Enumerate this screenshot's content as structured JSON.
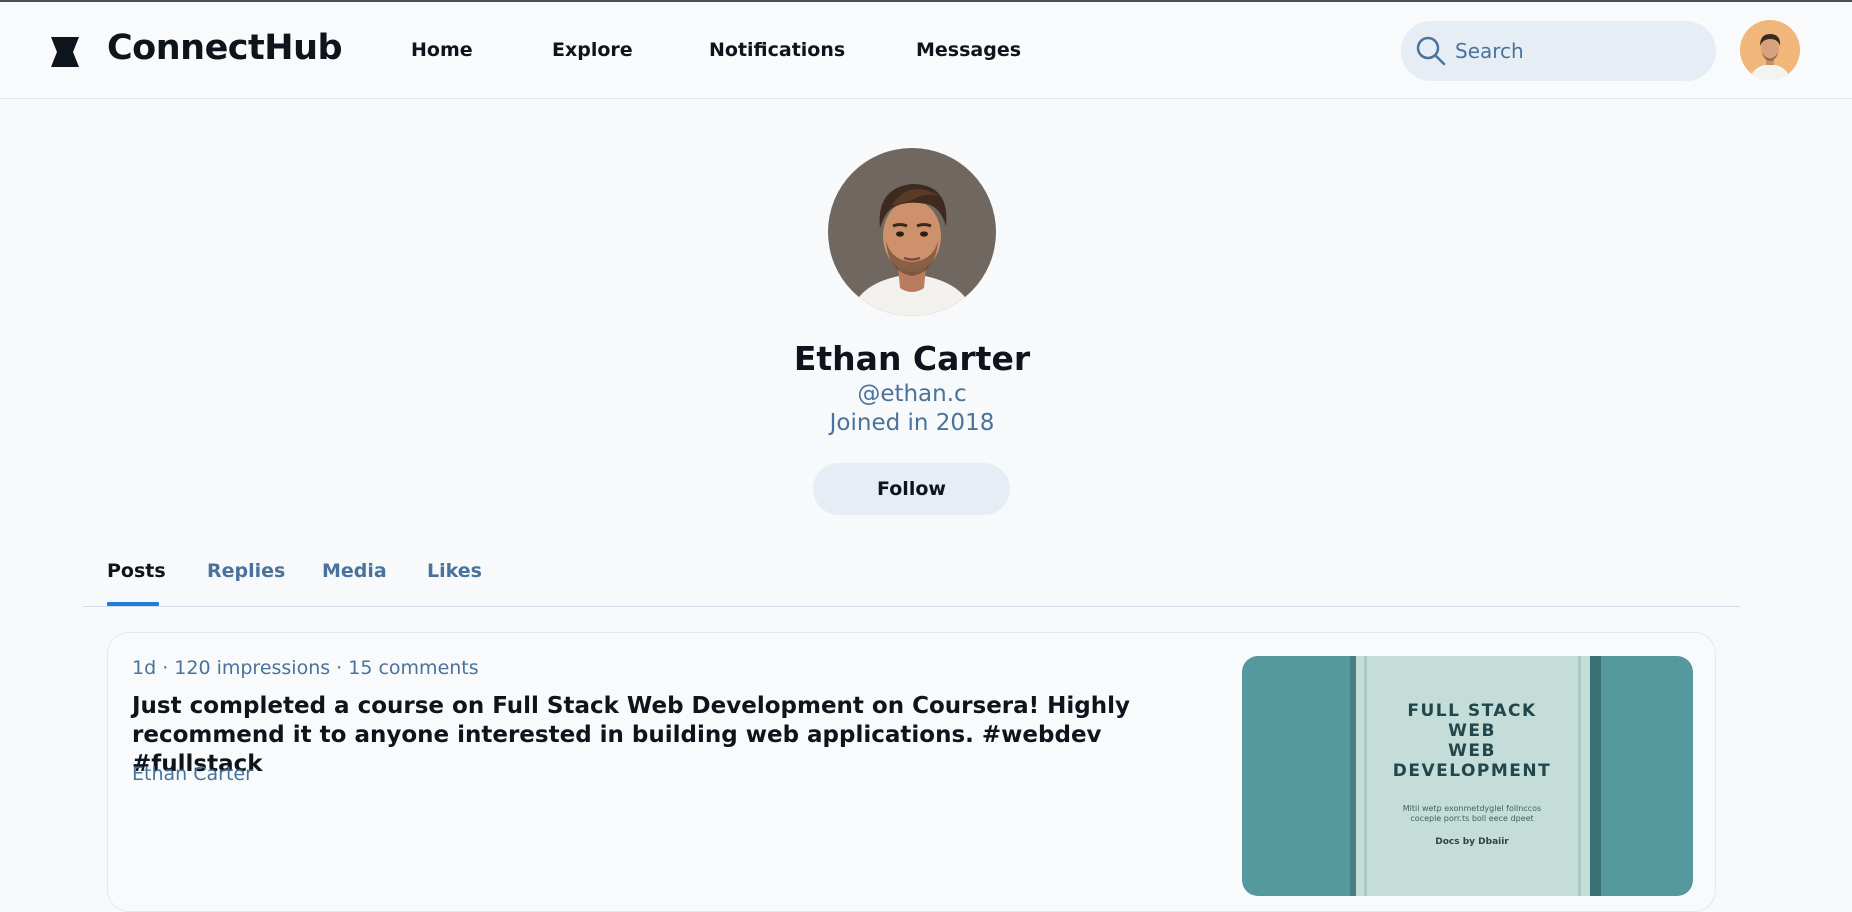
{
  "app": {
    "brand": "ConnectHub"
  },
  "nav": {
    "items": [
      "Home",
      "Explore",
      "Notifications",
      "Messages"
    ]
  },
  "search": {
    "placeholder": "Search"
  },
  "profile": {
    "name": "Ethan Carter",
    "handle": "@ethan.c",
    "joined": "Joined in 2018",
    "follow_label": "Follow"
  },
  "tabs": [
    {
      "label": "Posts",
      "active": true
    },
    {
      "label": "Replies",
      "active": false
    },
    {
      "label": "Media",
      "active": false
    },
    {
      "label": "Likes",
      "active": false
    }
  ],
  "post": {
    "meta": "1d · 120 impressions · 15 comments",
    "body": "Just completed a course on Full Stack Web Development on Coursera! Highly recommend it to anyone interested in building web applications. #webdev #fullstack",
    "author": "Ethan Carter",
    "image": {
      "title_lines": [
        "FULL STACK",
        "WEB",
        "WEB",
        "DEVELOPMENT"
      ],
      "subtitle_lines": [
        "Mltii wetp exonmetdyglel follnccos",
        "coceple porr.ts boll eece dpeet"
      ],
      "byline": "Docs by Dbaiir"
    }
  },
  "colors": {
    "accent": "#1f7de0",
    "muted_text": "#49739c",
    "pill_bg": "#e7edf4",
    "image_teal": "#55999f",
    "book_cover": "#c5ddd8"
  },
  "icons": {
    "logo": "logo-icon",
    "search": "search-icon"
  }
}
